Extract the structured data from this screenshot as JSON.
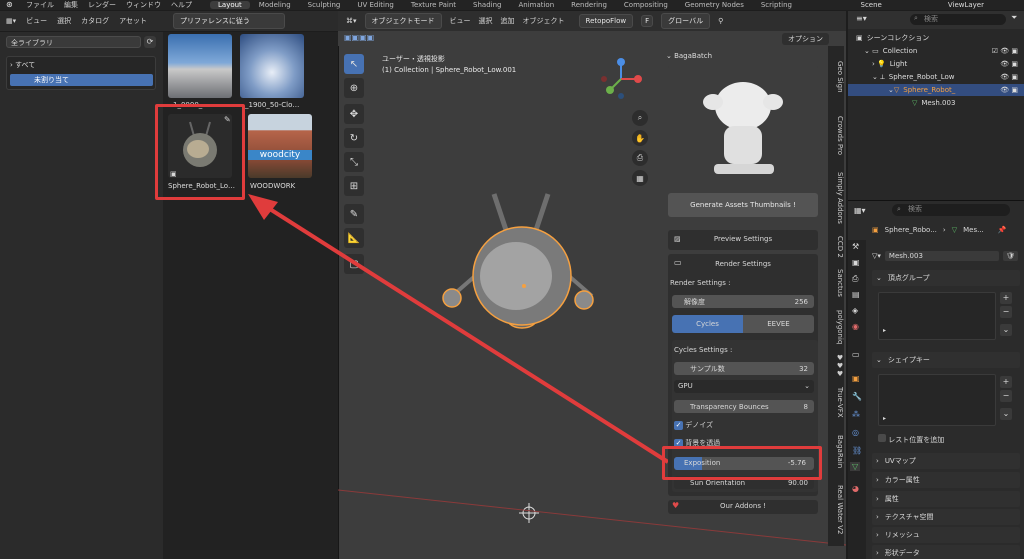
{
  "topbar": {
    "menu": [
      "ファイル",
      "編集",
      "レンダー",
      "ウィンドウ",
      "ヘルプ"
    ],
    "workspaces": [
      "Layout",
      "Modeling",
      "Sculpting",
      "UV Editing",
      "Texture Paint",
      "Shading",
      "Animation",
      "Rendering",
      "Compositing",
      "Geometry Nodes",
      "Scripting"
    ],
    "active_workspace": "Layout",
    "scene": "Scene",
    "view_layer": "ViewLayer"
  },
  "asset_browser": {
    "header_menu": [
      "ビュー",
      "選択",
      "カタログ",
      "アセット"
    ],
    "import_mode": "プリファレンスに従う",
    "library": "全ライブラリ",
    "catalog_all": "すべて",
    "catalog_unassigned": "未割り当て",
    "assets": [
      {
        "label": "…1_0000_…"
      },
      {
        "label": "…_1900_50-Clo…"
      },
      {
        "label": "Sphere_Robot_Lo…"
      },
      {
        "label": "WOODWORK"
      }
    ],
    "woodwork_watermark": "woodcity"
  },
  "viewport": {
    "mode": "オブジェクトモード",
    "menu": [
      "ビュー",
      "選択",
      "追加",
      "オブジェクト"
    ],
    "addon": "RetopoFlow",
    "addon_key": "F",
    "transform_orientation": "グローバル",
    "options_label": "オプション",
    "view_name": "ユーザー・透視投影",
    "collection_info": "(1) Collection | Sphere_Robot_Low.001",
    "axis_labels": [
      "X",
      "Y",
      "Z"
    ]
  },
  "bagabatch": {
    "title": "BagaBatch",
    "generate_btn": "Generate Assets Thumbnails !",
    "preview_settings": "Preview Settings",
    "render_settings": "Render Settings",
    "render_settings_label": "Render Settings :",
    "resolution_label": "解像度",
    "resolution_value": "256",
    "engine_cycles": "Cycles",
    "engine_eevee": "EEVEE",
    "cycles_settings_label": "Cycles Settings :",
    "samples_label": "サンプル数",
    "samples_value": "32",
    "device": "GPU",
    "transparency_label": "Transparency Bounces",
    "transparency_value": "8",
    "denoise_label": "デノイズ",
    "bg_transparent_label": "背景を透過",
    "exposition_label": "Exposition",
    "exposition_value": "-5.76",
    "exposition_fill": 0.2,
    "sun_label": "Sun Orientation",
    "sun_value": "90.00",
    "our_addons": "Our Addons !"
  },
  "side_tabs": [
    "Geo Sign",
    "Crowds Pro",
    "Simply Addons",
    "CCD 2",
    "Sanctus",
    "polygoniq",
    "♥♥♥",
    "True-VFX",
    "BagaRain",
    "Real Water V2"
  ],
  "outliner": {
    "search_placeholder": "検索",
    "scene_collection": "シーンコレクション",
    "rows": [
      {
        "label": "Collection",
        "indent": 1
      },
      {
        "label": "Light",
        "indent": 2
      },
      {
        "label": "Sphere_Robot_Low",
        "indent": 2
      },
      {
        "label": "Sphere_Robot_",
        "indent": 3,
        "selected": true
      },
      {
        "label": "Mesh.003",
        "indent": 4
      }
    ]
  },
  "properties": {
    "search_placeholder": "検索",
    "breadcrumb_object": "Sphere_Robo...",
    "breadcrumb_mesh": "Mes...",
    "mesh_name": "Mesh.003",
    "vertex_groups": "頂点グループ",
    "shape_keys": "シェイプキー",
    "relative_label": "レスト位置を追加",
    "sections": [
      "UVマップ",
      "カラー属性",
      "属性",
      "テクスチャ空間",
      "リメッシュ",
      "形状データ"
    ]
  },
  "colors": {
    "accent": "#4772b3",
    "highlight": "#e03c3c",
    "selection_orange": "#f5a040"
  }
}
